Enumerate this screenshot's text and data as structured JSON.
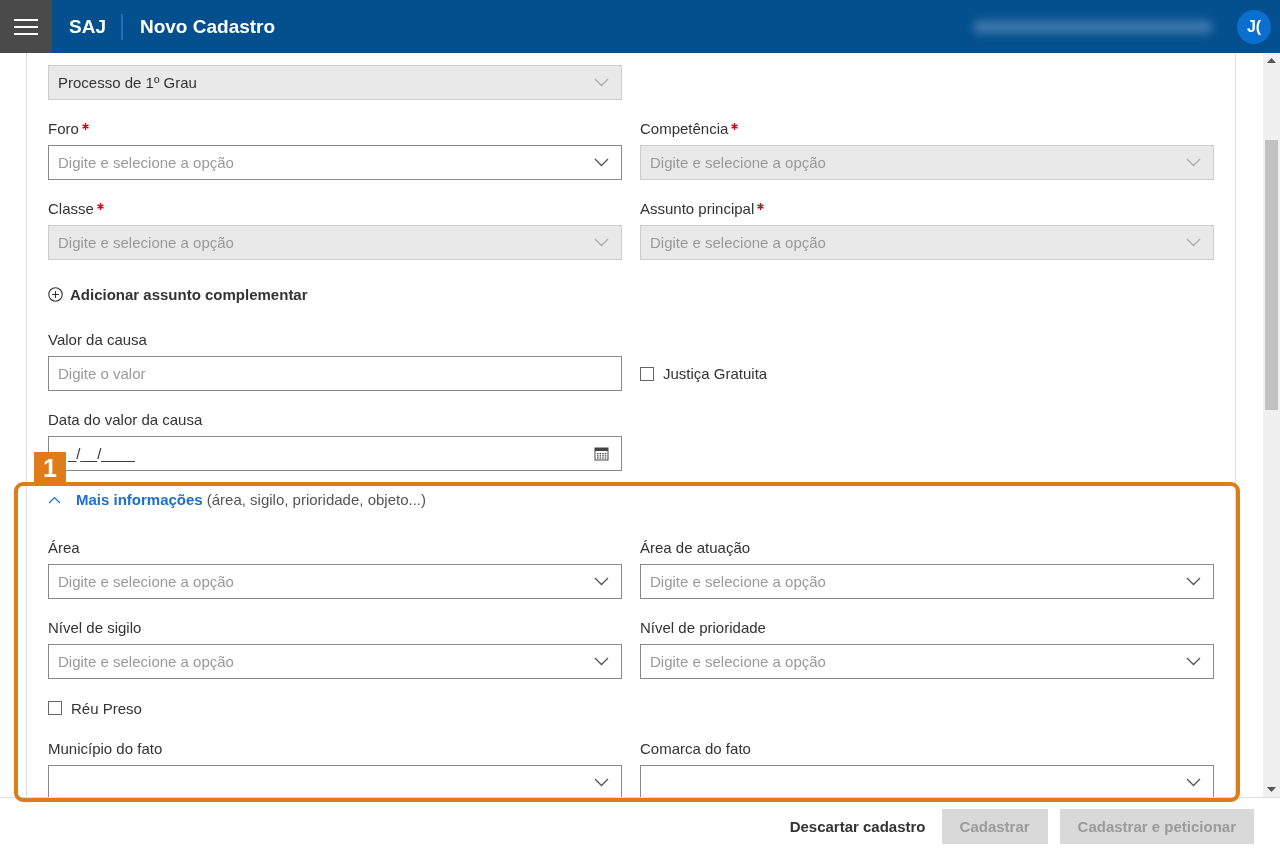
{
  "header": {
    "logo": "SAJ",
    "title": "Novo Cadastro",
    "avatar": "J("
  },
  "form": [
    {
      "kind": "fields",
      "items": [
        {
          "kind": "select",
          "value": "Processo de 1º Grau",
          "disabled": true
        }
      ]
    },
    {
      "kind": "fields",
      "items": [
        {
          "kind": "select",
          "label": "Foro",
          "required": true,
          "placeholder": "Digite e selecione a opção",
          "disabled": false
        },
        {
          "kind": "select",
          "label": "Competência",
          "required": true,
          "placeholder": "Digite e selecione a opção",
          "disabled": true
        }
      ]
    },
    {
      "kind": "fields",
      "items": [
        {
          "kind": "select",
          "label": "Classe",
          "required": true,
          "placeholder": "Digite e selecione a opção",
          "disabled": true
        },
        {
          "kind": "select",
          "label": "Assunto principal",
          "required": true,
          "placeholder": "Digite e selecione a opção",
          "disabled": true
        }
      ]
    },
    {
      "kind": "link",
      "text": "Adicionar assunto complementar"
    },
    {
      "kind": "fields",
      "items": [
        {
          "kind": "text",
          "label": "Valor da causa",
          "placeholder": "Digite o valor",
          "disabled": false
        },
        {
          "kind": "checkbox",
          "text": "Justiça Gratuita",
          "checked": false
        }
      ]
    },
    {
      "kind": "fields",
      "items": [
        {
          "kind": "date",
          "label": "Data do valor da causa",
          "value": "_/__/____",
          "disabled": false
        }
      ]
    },
    {
      "kind": "section",
      "title": "Mais informações",
      "hint": "(área, sigilo, prioridade, objeto...)",
      "expanded": true
    },
    {
      "kind": "fields",
      "items": [
        {
          "kind": "select",
          "label": "Área",
          "required": false,
          "placeholder": "Digite e selecione a opção",
          "disabled": false
        },
        {
          "kind": "select",
          "label": "Área de atuação",
          "required": false,
          "placeholder": "Digite e selecione a opção",
          "disabled": false
        }
      ]
    },
    {
      "kind": "fields",
      "items": [
        {
          "kind": "select",
          "label": "Nível de sigilo",
          "required": false,
          "placeholder": "Digite e selecione a opção",
          "disabled": false
        },
        {
          "kind": "select",
          "label": "Nível de prioridade",
          "required": false,
          "placeholder": "Digite e selecione a opção",
          "disabled": false
        }
      ]
    },
    {
      "kind": "checkrow",
      "text": "Réu Preso",
      "checked": false
    },
    {
      "kind": "fields",
      "items": [
        {
          "kind": "select",
          "label": "Município do fato",
          "required": false,
          "disabled": false
        },
        {
          "kind": "select",
          "label": "Comarca do fato",
          "required": false,
          "disabled": false
        }
      ]
    }
  ],
  "footer": [
    {
      "label": "Descartar cadastro",
      "kind": "text",
      "disabled": false
    },
    {
      "label": "Cadastrar",
      "kind": "solid",
      "disabled": true
    },
    {
      "label": "Cadastrar e peticionar",
      "kind": "solid",
      "disabled": true
    }
  ],
  "annotation": {
    "number": "1"
  }
}
